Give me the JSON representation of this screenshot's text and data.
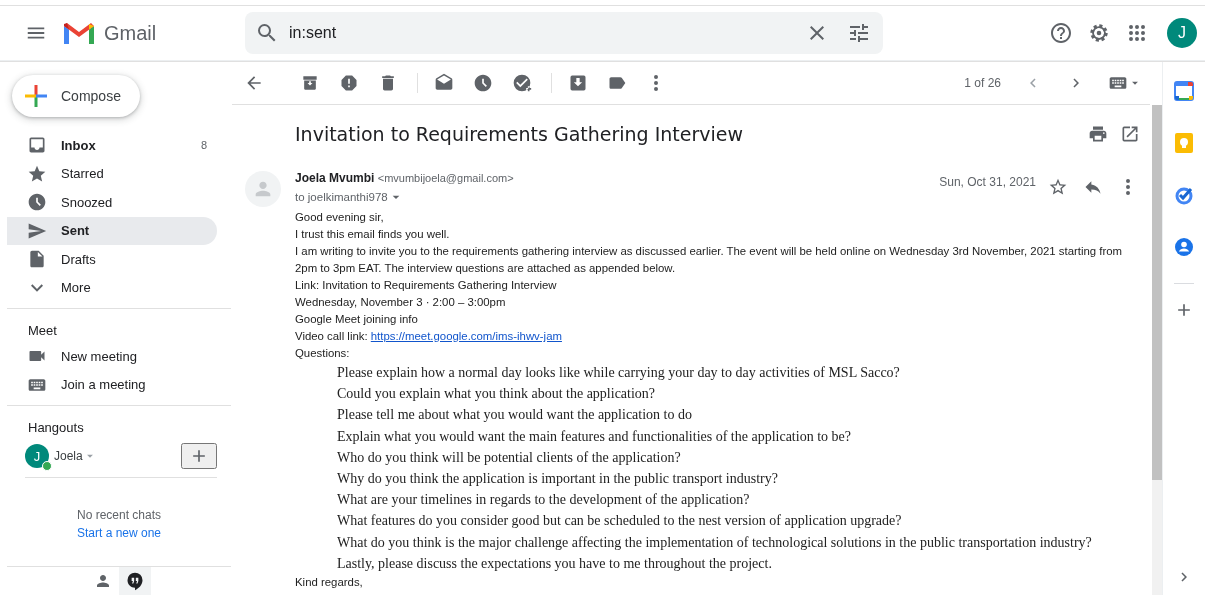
{
  "topbar": {
    "product": "Gmail",
    "search": {
      "value": "in:sent"
    },
    "avatar": "J"
  },
  "sidebar": {
    "compose": "Compose",
    "items": [
      {
        "label": "Inbox",
        "count": "8",
        "unread": true,
        "selected": false
      },
      {
        "label": "Starred",
        "unread": false,
        "selected": false
      },
      {
        "label": "Snoozed",
        "unread": false,
        "selected": false
      },
      {
        "label": "Sent",
        "unread": true,
        "selected": true
      },
      {
        "label": "Drafts",
        "unread": false,
        "selected": false
      },
      {
        "label": "More",
        "unread": false,
        "selected": false
      }
    ],
    "meet": {
      "title": "Meet",
      "items": [
        "New meeting",
        "Join a meeting"
      ]
    },
    "hangouts": {
      "title": "Hangouts",
      "user": {
        "initial": "J",
        "name": "Joela",
        "online": true
      },
      "empty": "No recent chats",
      "link": "Start a new one"
    },
    "bottom_tabs": [
      {
        "selected": false
      },
      {
        "selected": true
      }
    ]
  },
  "toolbar": {
    "counter": "1 of 26"
  },
  "message": {
    "subject": "Invitation to Requirements Gathering Interview",
    "sender": "Joela Mvumbi",
    "email": "<mvumbijoela@gmail.com>",
    "to": "to joelkimanthi978",
    "date": "Sun, Oct 31, 2021",
    "starred": false,
    "body": [
      {
        "kind": "text",
        "text": "Good evening sir,"
      },
      {
        "kind": "text",
        "text": "I trust this email finds you well."
      },
      {
        "kind": "text",
        "text": "I am writing to invite you to the requirements gathering interview as discussed earlier. The event will be held online on Wednesday 3rd November, 2021 starting from 2pm to 3pm EAT. The interview questions are attached  as appended below."
      },
      {
        "kind": "text",
        "text": "Link: Invitation to Requirements Gathering Interview"
      },
      {
        "kind": "text",
        "text": "Wednesday, November 3 · 2:00 – 3:00pm"
      },
      {
        "kind": "text",
        "text": "Google Meet joining info"
      },
      {
        "kind": "link",
        "text": "Video call link:",
        "url": "https://meet.google.com/ims-ihwv-jam"
      },
      {
        "kind": "text",
        "text": "Questions:"
      },
      {
        "kind": "question",
        "text": "Please explain how a normal day looks like while carrying your day to day activities of MSL Sacco?"
      },
      {
        "kind": "question",
        "text": "Could you explain what you think about the application?"
      },
      {
        "kind": "question",
        "text": "Please tell me about what you would want the application to do"
      },
      {
        "kind": "question",
        "text": "Explain what you would want the main features and functionalities of the application to be?"
      },
      {
        "kind": "question",
        "text": "Who do you think will be potential clients of the application?"
      },
      {
        "kind": "question",
        "text": "Why do you think the application is important in the public transport industry?"
      },
      {
        "kind": "question",
        "text": "What are your timelines in regards to the development of the application?"
      },
      {
        "kind": "question",
        "text": "What features do you consider good but can be scheduled to the nest version of application upgrade?"
      },
      {
        "kind": "question",
        "text": "What do you think is the major challenge affecting the implementation of technological solutions in the public transportation industry?"
      },
      {
        "kind": "question",
        "text": "Lastly, please discuss the expectations you have to me throughout the project."
      },
      {
        "kind": "text",
        "text": "Kind regards,"
      }
    ]
  }
}
